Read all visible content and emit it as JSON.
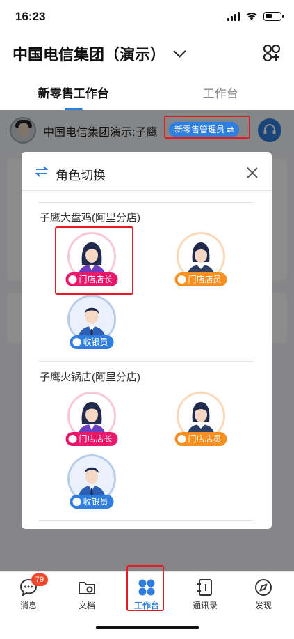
{
  "status": {
    "time": "16:23"
  },
  "header": {
    "org_title": "中国电信集团（演示）",
    "tabs": [
      {
        "label": "新零售工作台",
        "active": true
      },
      {
        "label": "工作台",
        "active": false
      }
    ]
  },
  "user_bar": {
    "name": "中国电信集团演示:子鹰",
    "role_badge": "新零售管理员 ⇄"
  },
  "modal": {
    "title": "角色切换",
    "stores": [
      {
        "name": "子鹰大盘鸡(阿里分店)",
        "roles": [
          {
            "label": "门店店长",
            "color": "#e8196b",
            "icon": "manager-avatar",
            "selected": true
          },
          {
            "label": "门店店员",
            "color": "#f79022",
            "icon": "clerk-avatar"
          },
          {
            "label": "收银员",
            "color": "#2f7fe0",
            "icon": "cashier-avatar"
          }
        ]
      },
      {
        "name": "子鹰火锅店(阿里分店)",
        "roles": [
          {
            "label": "门店店长",
            "color": "#e8196b",
            "icon": "manager-avatar"
          },
          {
            "label": "门店店员",
            "color": "#f79022",
            "icon": "clerk-avatar"
          },
          {
            "label": "收银员",
            "color": "#2f7fe0",
            "icon": "cashier-avatar"
          }
        ]
      }
    ]
  },
  "bottom_nav": [
    {
      "label": "消息",
      "icon": "message-icon",
      "badge": "79"
    },
    {
      "label": "文档",
      "icon": "folder-icon"
    },
    {
      "label": "工作台",
      "icon": "workbench-icon",
      "active": true
    },
    {
      "label": "通讯录",
      "icon": "contacts-icon"
    },
    {
      "label": "发现",
      "icon": "compass-icon"
    }
  ],
  "colors": {
    "accent": "#2f7fe0",
    "highlight": "#e31b23",
    "badge": "#f0462c"
  }
}
